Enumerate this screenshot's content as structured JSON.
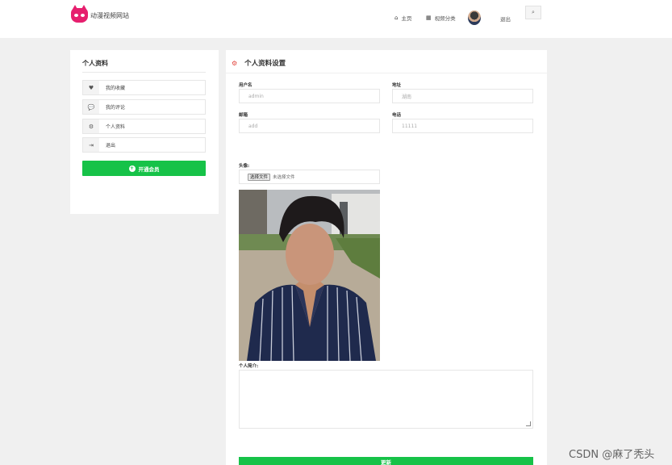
{
  "header": {
    "site_name": "动漫视频网站",
    "nav_home": "主页",
    "nav_categories": "视频分类",
    "logout": "退出"
  },
  "sidebar": {
    "title": "个人资料",
    "items": [
      {
        "label": "我的收藏",
        "icon": "heart-icon"
      },
      {
        "label": "我的评论",
        "icon": "comments-icon"
      },
      {
        "label": "个人资料",
        "icon": "gears-icon"
      },
      {
        "label": "退出",
        "icon": "sign-out-icon"
      }
    ],
    "vip_button": "开通会员"
  },
  "main": {
    "title": "个人资料设置",
    "fields": {
      "username_label": "用户名",
      "username_value": "admin",
      "address_label": "地址",
      "address_value": "湖南",
      "email_label": "邮箱",
      "email_value": "add",
      "phone_label": "电话",
      "phone_value": "11111"
    },
    "avatar_label": "头像:",
    "file_button": "选择文件",
    "file_status": "未选择文件",
    "bio_label": "个人简介:",
    "bio_value": "",
    "save_button": "更新"
  },
  "watermark": "CSDN @麻了秃头",
  "colors": {
    "brand": "#e61f6e",
    "accent_green": "#16c248",
    "title_icon_red": "#e2463e"
  }
}
